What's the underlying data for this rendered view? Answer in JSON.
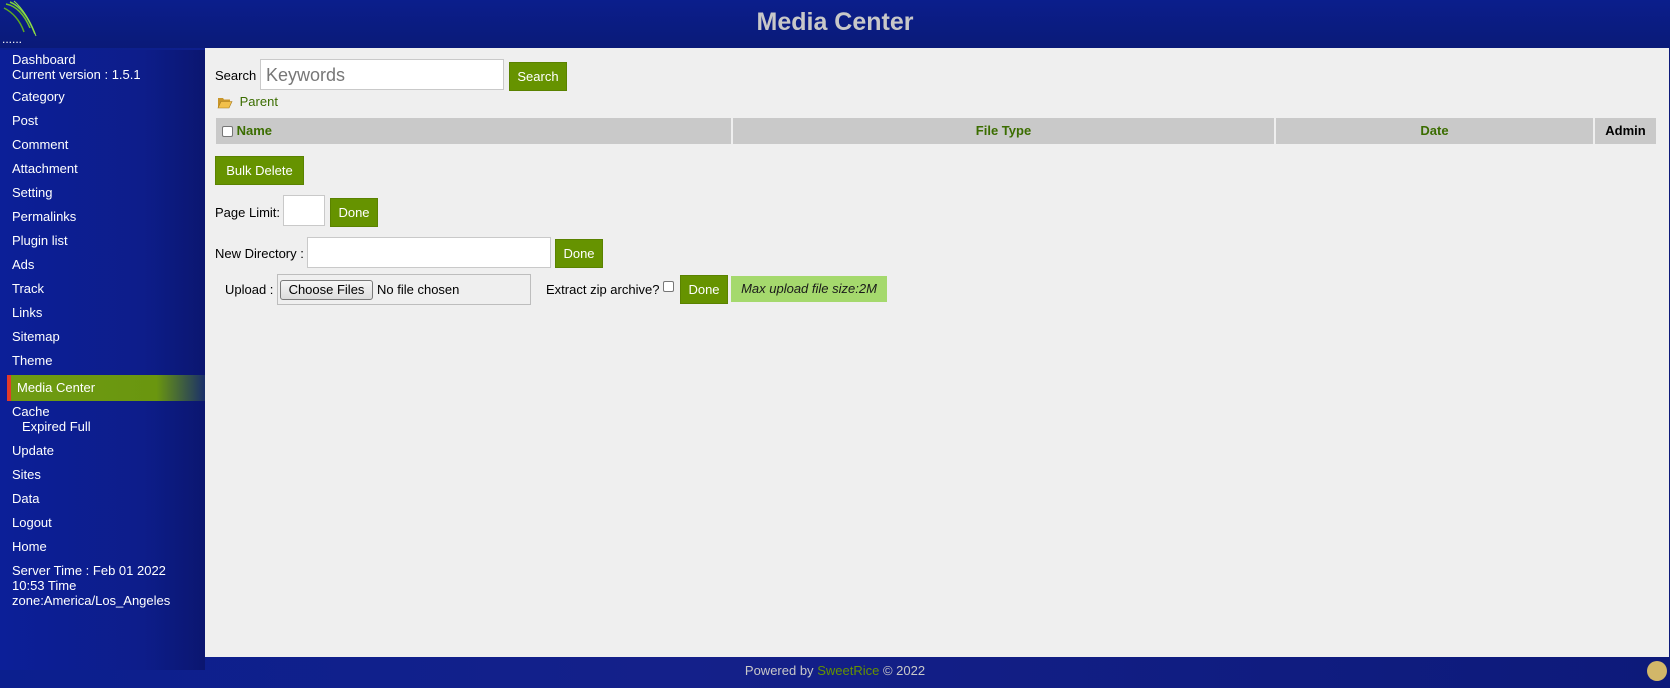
{
  "header": {
    "title": "Media Center",
    "dots": "......"
  },
  "sidebar": {
    "items": [
      {
        "label": "Dashboard",
        "sub": "Current version : 1.5.1"
      },
      {
        "label": "Category"
      },
      {
        "label": "Post"
      },
      {
        "label": "Comment"
      },
      {
        "label": "Attachment"
      },
      {
        "label": "Setting"
      },
      {
        "label": "Permalinks"
      },
      {
        "label": "Plugin list"
      },
      {
        "label": "Ads"
      },
      {
        "label": "Track"
      },
      {
        "label": "Links"
      },
      {
        "label": "Sitemap"
      },
      {
        "label": "Theme"
      },
      {
        "label": "Media Center",
        "active": true
      },
      {
        "label": "Cache",
        "sub": "Expired Full"
      },
      {
        "label": "Update"
      },
      {
        "label": "Sites"
      },
      {
        "label": "Data"
      },
      {
        "label": "Logout"
      },
      {
        "label": "Home"
      }
    ],
    "server_time": "Server Time : Feb 01 2022 10:53 Time zone:America/Los_Angeles"
  },
  "main": {
    "search_label": "Search",
    "search_placeholder": "Keywords",
    "search_button": "Search",
    "parent_link": "Parent",
    "table": {
      "columns": [
        "Name",
        "File Type",
        "Date",
        "Admin"
      ]
    },
    "bulk_delete": "Bulk Delete",
    "page_limit_label": "Page Limit:",
    "page_limit_value": "",
    "done_label": "Done",
    "new_directory_label": "New Directory :",
    "new_directory_value": "",
    "upload_label": "Upload :",
    "choose_files": "Choose Files",
    "no_file": "No file chosen",
    "extract_label": "Extract zip archive?",
    "max_upload": "Max upload file size:2M"
  },
  "footer": {
    "powered_by": "Powered by",
    "brand": "SweetRice",
    "copyright": "© 2022"
  },
  "colors": {
    "accent_green": "#669300",
    "active_marker": "#e23a2a",
    "header_blue": "#0b1e8c"
  }
}
